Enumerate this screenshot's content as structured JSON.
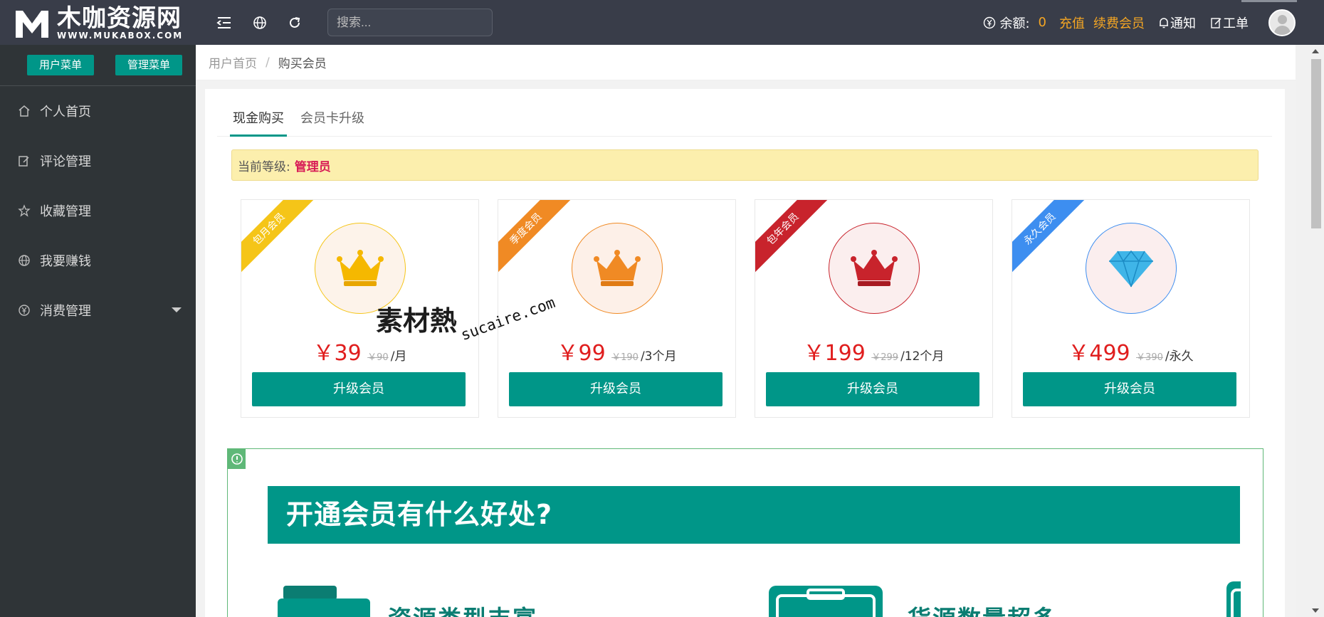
{
  "brand": {
    "name": "木咖资源网",
    "domain": "WWW.MUKABOX.COM"
  },
  "sidebar": {
    "menu_tabs": [
      "用户菜单",
      "管理菜单"
    ],
    "items": [
      {
        "label": "个人首页",
        "icon": "home-icon"
      },
      {
        "label": "评论管理",
        "icon": "edit-icon"
      },
      {
        "label": "收藏管理",
        "icon": "star-icon"
      },
      {
        "label": "我要赚钱",
        "icon": "globe-icon"
      },
      {
        "label": "消费管理",
        "icon": "yen-icon",
        "expandable": true
      }
    ]
  },
  "header": {
    "search_placeholder": "搜索...",
    "balance_label": "余额:",
    "balance_value": "0",
    "recharge": "充值",
    "renew": "续费会员",
    "notify": "通知",
    "ticket": "工单"
  },
  "breadcrumb": {
    "home": "用户首页",
    "sep": "/",
    "current": "购买会员"
  },
  "tabs": [
    "现金购买",
    "会员卡升级"
  ],
  "notice": {
    "label": "当前等级:",
    "level": "管理员"
  },
  "plans": [
    {
      "ribbon": "包月会员",
      "price": "￥39",
      "old": "￥90",
      "unit": "/月",
      "button": "升级会员",
      "color": "#f5c518",
      "icon": "crown-icon"
    },
    {
      "ribbon": "季度会员",
      "price": "￥99",
      "old": "￥190",
      "unit": "/3个月",
      "button": "升级会员",
      "color": "#f08a24",
      "icon": "crown-icon"
    },
    {
      "ribbon": "包年会员",
      "price": "￥199",
      "old": "￥299",
      "unit": "/12个月",
      "button": "升级会员",
      "color": "#c8232c",
      "icon": "crown-icon"
    },
    {
      "ribbon": "永久会员",
      "price": "￥499",
      "old": "￥390",
      "unit": "/永久",
      "button": "升级会员",
      "color": "#3d8ef0",
      "icon": "diamond-icon"
    }
  ],
  "watermark": {
    "cn": "素材熱",
    "en": "sucaire.com"
  },
  "promo": {
    "title": "开通会员有什么好处?",
    "features": [
      "资源类型丰富",
      "货源数量超多"
    ]
  },
  "colors": {
    "accent": "#009688",
    "sidebar_bg": "#2f3437",
    "header_bg": "#393d49",
    "price": "#e01e1e"
  }
}
